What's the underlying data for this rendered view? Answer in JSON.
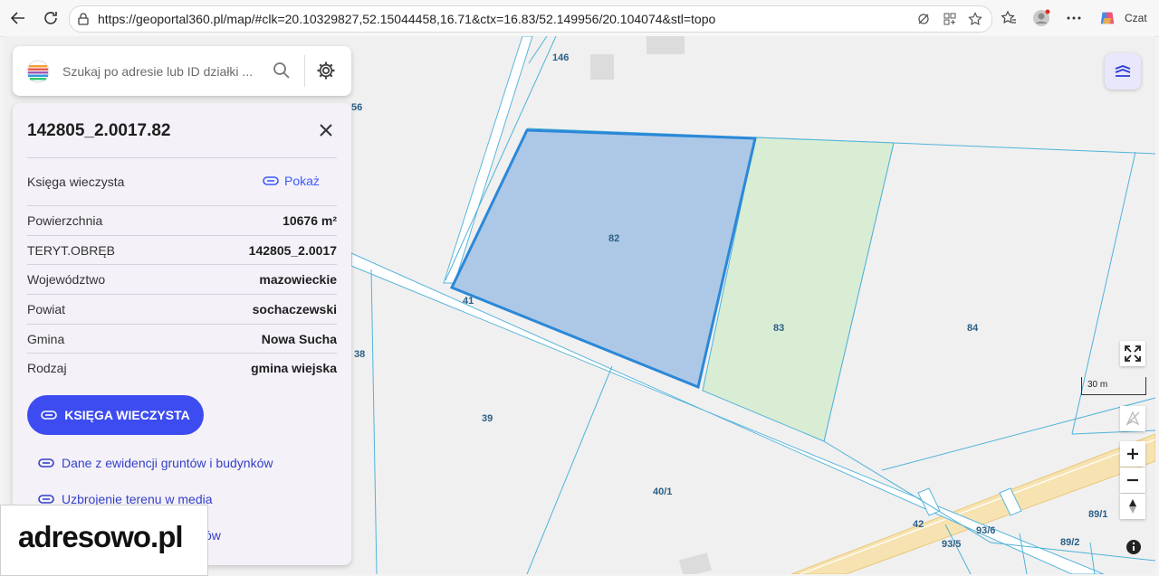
{
  "browser": {
    "url": "https://geoportal360.pl/map/#clk=20.10329827,52.15044458,16.71&ctx=16.83/52.149956/20.104074&stl=topo",
    "copilot_label": "Czat"
  },
  "search": {
    "placeholder": "Szukaj po adresie lub ID działki ..."
  },
  "parcel": {
    "title": "142805_2.0017.82",
    "kw_label": "Księga wieczysta",
    "show_label": "Pokaż",
    "rows": [
      {
        "label": "Powierzchnia",
        "value": "10676 m²"
      },
      {
        "label": "TERYT.OBRĘB",
        "value": "142805_2.0017"
      },
      {
        "label": "Województwo",
        "value": "mazowieckie"
      },
      {
        "label": "Powiat",
        "value": "sochaczewski"
      },
      {
        "label": "Gmina",
        "value": "Nowa Sucha"
      },
      {
        "label": "Rodzaj",
        "value": "gmina wiejska"
      }
    ],
    "kw_button": "KSIĘGA WIECZYSTA",
    "links": [
      "Dane z ewidencji gruntów i budynków",
      "Uzbrojenie terenu w media",
      "ów"
    ]
  },
  "logo": {
    "text": "adresowo.pl"
  },
  "map": {
    "parcel_labels": [
      "146",
      "56",
      "82",
      "41",
      "83",
      "84",
      "38",
      "39",
      "40/1",
      "42",
      "93/6",
      "93/5",
      "89/2",
      "89/1"
    ],
    "scale_label": "30 m",
    "colors": {
      "selected_fill": "#adc8e6",
      "selected_stroke": "#2b88d8",
      "neighbor_fill": "#d9ecd4",
      "road_fill": "#f7e3b1",
      "parcel_line": "#4fb3d9"
    }
  }
}
